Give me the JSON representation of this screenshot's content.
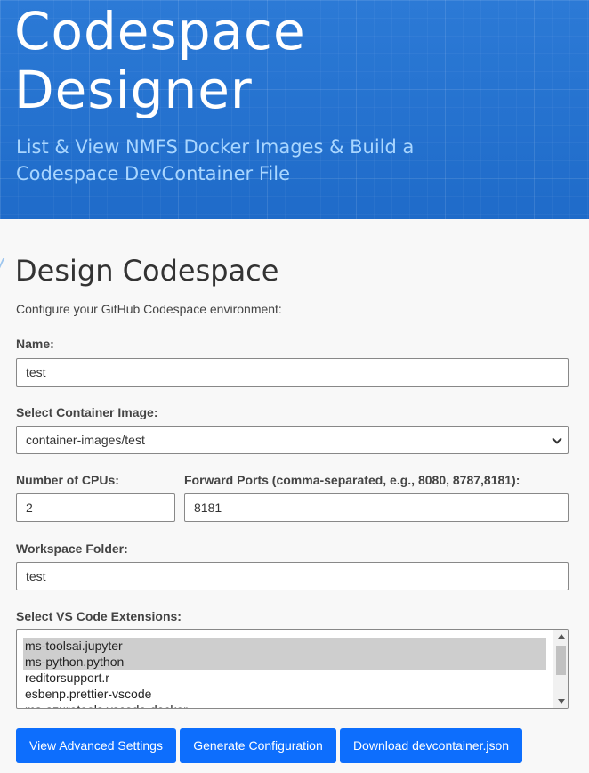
{
  "header": {
    "title": "Codespace Designer",
    "subtitle": "List & View NMFS Docker Images & Build a Codespace DevContainer File"
  },
  "section": {
    "title": "Design Codespace",
    "description": "Configure your GitHub Codespace environment:"
  },
  "form": {
    "name": {
      "label": "Name:",
      "value": "test"
    },
    "container_image": {
      "label": "Select Container Image:",
      "value": "container-images/test"
    },
    "cpus": {
      "label": "Number of CPUs:",
      "value": "2"
    },
    "ports": {
      "label": "Forward Ports (comma-separated, e.g., 8080, 8787,8181):",
      "value": "8181"
    },
    "workspace": {
      "label": "Workspace Folder:",
      "value": "test"
    },
    "extensions": {
      "label": "Select VS Code Extensions:",
      "items": [
        {
          "label": "ms-toolsai.jupyter",
          "selected": true
        },
        {
          "label": "ms-python.python",
          "selected": true
        },
        {
          "label": "reditorsupport.r",
          "selected": false
        },
        {
          "label": "esbenp.prettier-vscode",
          "selected": false
        },
        {
          "label": "ms-azuretools.vscode-docker",
          "selected": false
        }
      ]
    }
  },
  "buttons": {
    "advanced": "View Advanced Settings",
    "generate": "Generate Configuration",
    "download": "Download devcontainer.json"
  },
  "colors": {
    "header_bg": "#2a77d2",
    "subtitle": "#a9d6ff",
    "button_bg": "#0d6efd",
    "selected_item": "#cecece"
  }
}
